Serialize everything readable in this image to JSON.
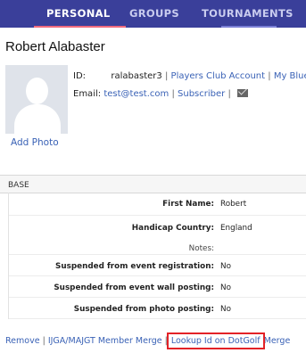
{
  "nav": {
    "tabs": [
      {
        "label": "PERSONAL",
        "active": true
      },
      {
        "label": "GROUPS",
        "active": false
      },
      {
        "label": "TOURNAMENTS",
        "active": false
      }
    ]
  },
  "profile": {
    "name": "Robert Alabaster",
    "add_photo": "Add Photo",
    "id_label": "ID:",
    "id_value": "ralabaster3",
    "id_links": [
      "Players Club Account",
      "My BlueG"
    ],
    "email_label": "Email:",
    "email_value": "test@test.com",
    "email_status": "Subscriber",
    "sep": "|",
    "mail_icon": "envelope-icon"
  },
  "base": {
    "title": "BASE",
    "rows": [
      {
        "label": "First Name:",
        "value": "Robert"
      },
      {
        "label": "Handicap Country:",
        "value": "England"
      },
      {
        "label": "Notes:",
        "value": ""
      },
      {
        "label": "Suspended from event registration:",
        "value": "No"
      },
      {
        "label": "Suspended from event wall posting:",
        "value": "No"
      },
      {
        "label": "Suspended from photo posting:",
        "value": "No"
      }
    ]
  },
  "footer": {
    "links": [
      "Remove",
      "IJGA/MAJGT Member Merge",
      "Lookup Id on DotGolf",
      "Merge"
    ],
    "sep": "|",
    "highlight_color": "#e32227"
  },
  "colors": {
    "nav_bg": "#3a3f9a",
    "link": "#3a62b6",
    "active_underline": "#f06a7e"
  }
}
